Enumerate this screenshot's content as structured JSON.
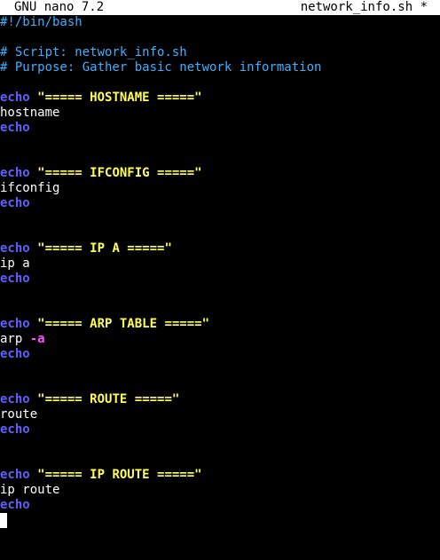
{
  "titlebar": {
    "app": "GNU nano 7.2",
    "filename": "network_info.sh *"
  },
  "editor": {
    "shebang": "#!/bin/bash",
    "comment_script": "# Script: network_info.sh",
    "comment_purpose": "# Purpose: Gather basic network information",
    "sections": [
      {
        "echo": "echo",
        "header": "\"===== HOSTNAME =====\"",
        "cmd": "hostname",
        "flag": "",
        "echo_after": "echo"
      },
      {
        "echo": "echo",
        "header": "\"===== IFCONFIG =====\"",
        "cmd": "ifconfig",
        "flag": "",
        "echo_after": "echo"
      },
      {
        "echo": "echo",
        "header": "\"===== IP A =====\"",
        "cmd": "ip a",
        "flag": "",
        "echo_after": "echo"
      },
      {
        "echo": "echo",
        "header": "\"===== ARP TABLE =====\"",
        "cmd": "arp ",
        "flag": "-a",
        "echo_after": "echo"
      },
      {
        "echo": "echo",
        "header": "\"===== ROUTE =====\"",
        "cmd": "route",
        "flag": "",
        "echo_after": "echo"
      },
      {
        "echo": "echo",
        "header": "\"===== IP ROUTE =====\"",
        "cmd": "ip route",
        "flag": "",
        "echo_after": "echo"
      }
    ]
  },
  "colors": {
    "background": "#000000",
    "titlebar_bg": "#ffffff",
    "comment": "#3fb0ff",
    "keyword": "#5f5fff",
    "string": "#ffff55",
    "flag": "#ff55ff"
  }
}
